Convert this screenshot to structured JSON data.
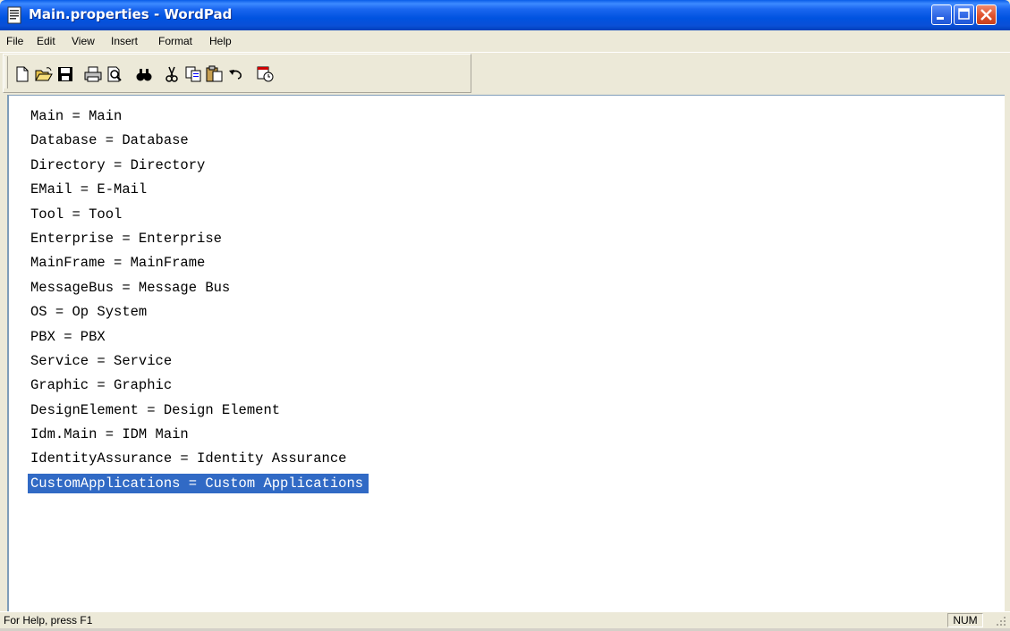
{
  "window": {
    "title": "Main.properties - WordPad"
  },
  "menu": [
    "File",
    "Edit",
    "View",
    "Insert",
    "Format",
    "Help"
  ],
  "toolbar": {
    "buttons": [
      "new-icon",
      "open-icon",
      "save-icon",
      "print-icon",
      "print-preview-icon",
      "find-icon",
      "cut-icon",
      "copy-icon",
      "paste-icon",
      "undo-icon",
      "date-time-icon"
    ]
  },
  "document": {
    "lines": [
      "Main = Main",
      "Database = Database",
      "Directory = Directory",
      "EMail = E-Mail",
      "Tool = Tool",
      "Enterprise = Enterprise",
      "MainFrame = MainFrame",
      "MessageBus = Message Bus",
      "OS = Op System",
      "PBX = PBX",
      "Service = Service",
      "Graphic = Graphic",
      "DesignElement = Design Element",
      "Idm.Main = IDM Main",
      "IdentityAssurance = Identity Assurance",
      "CustomApplications = Custom Applications"
    ],
    "selected_line": "CustomApplications = Custom Applications",
    "selection_color": "#316ac5"
  },
  "status": {
    "help": "For Help, press F1",
    "num": "NUM"
  }
}
